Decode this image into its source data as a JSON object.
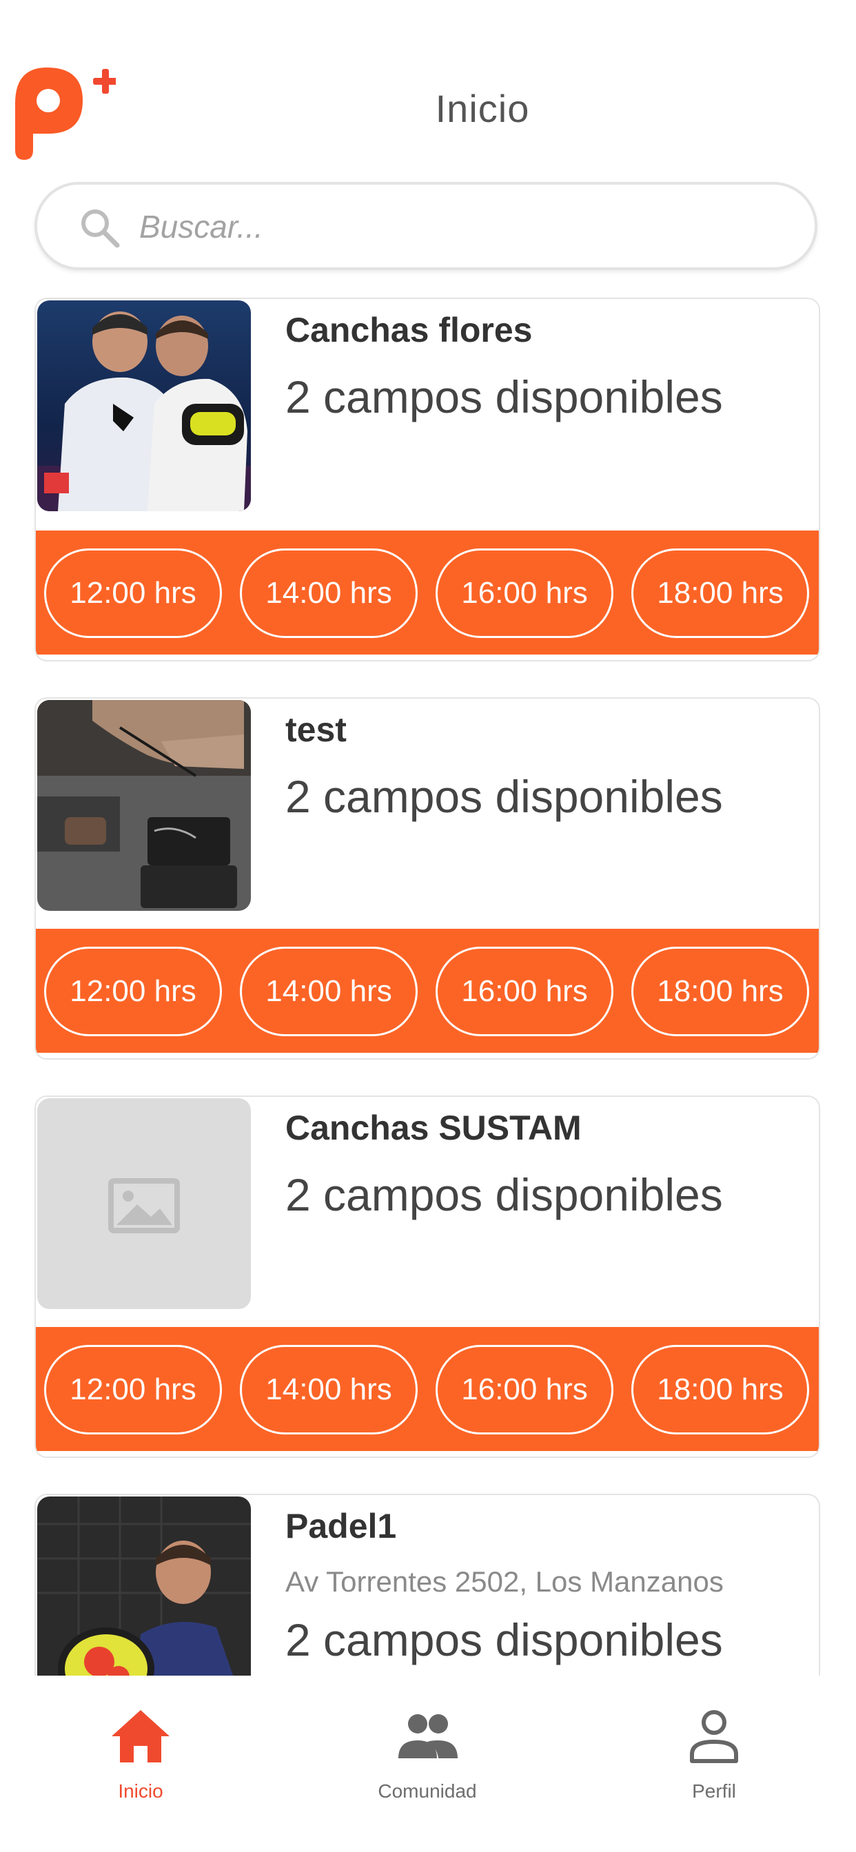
{
  "header": {
    "title": "Inicio",
    "logo_icon": "padel-plus-logo"
  },
  "search": {
    "placeholder": "Buscar..."
  },
  "colors": {
    "accent": "#FC6426",
    "active_nav": "#F04A2E",
    "placeholder_image": "#DCDCDC"
  },
  "venues": [
    {
      "name": "Canchas flores",
      "availability": "2 campos disponibles",
      "slots": [
        "12:00 hrs",
        "14:00 hrs",
        "16:00 hrs",
        "18:00 hrs"
      ]
    },
    {
      "name": "test",
      "availability": "2 campos disponibles",
      "slots": [
        "12:00 hrs",
        "14:00 hrs",
        "16:00 hrs",
        "18:00 hrs"
      ]
    },
    {
      "name": "Canchas SUSTAM",
      "availability": "2 campos disponibles",
      "slots": [
        "12:00 hrs",
        "14:00 hrs",
        "16:00 hrs",
        "18:00 hrs"
      ]
    },
    {
      "name": "Padel1",
      "address": "Av Torrentes 2502, Los Manzanos",
      "availability": "2 campos disponibles"
    }
  ],
  "nav": {
    "items": [
      {
        "label": "Inicio",
        "icon": "home-icon",
        "active": true
      },
      {
        "label": "Comunidad",
        "icon": "people-icon",
        "active": false
      },
      {
        "label": "Perfil",
        "icon": "person-icon",
        "active": false
      }
    ]
  }
}
